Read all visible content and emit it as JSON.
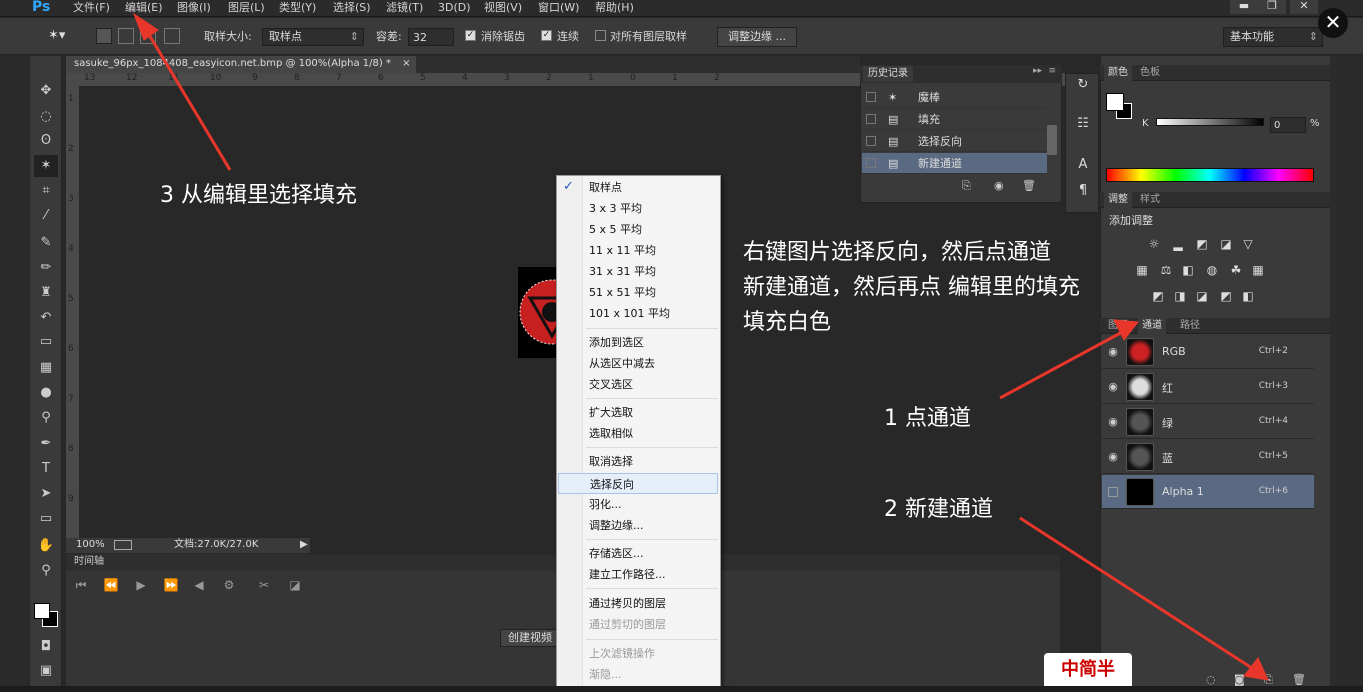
{
  "app": {
    "logo": "Ps"
  },
  "menubar": {
    "items": [
      {
        "label": "文件(F)"
      },
      {
        "label": "编辑(E)"
      },
      {
        "label": "图像(I)"
      },
      {
        "label": "图层(L)"
      },
      {
        "label": "类型(Y)"
      },
      {
        "label": "选择(S)"
      },
      {
        "label": "滤镜(T)"
      },
      {
        "label": "3D(D)"
      },
      {
        "label": "视图(V)"
      },
      {
        "label": "窗口(W)"
      },
      {
        "label": "帮助(H)"
      }
    ],
    "window_buttons": [
      "▬",
      "❐",
      "✕"
    ],
    "close_overlay": "✕"
  },
  "options": {
    "sample_size_label": "取样大小:",
    "sample_size_value": "取样点",
    "tolerance_label": "容差:",
    "tolerance_value": "32",
    "anti_alias_label": "消除锯齿",
    "contiguous_label": "连续",
    "all_layers_label": "对所有图层取样",
    "refine_edge_label": "调整边缘 ...",
    "workspace_label": "基本功能"
  },
  "document": {
    "tab_title": "sasuke_96px_1084408_easyicon.net.bmp @ 100%(Alpha 1/8) *",
    "tab_close": "×",
    "ruler_h": [
      "13",
      "12",
      "11",
      "10",
      "9",
      "8",
      "7",
      "6",
      "5",
      "4",
      "3",
      "2",
      "1",
      "0",
      "1",
      "2"
    ],
    "ruler_v": [
      "1",
      "2",
      "3",
      "4",
      "5",
      "6",
      "7",
      "8",
      "9"
    ],
    "zoom": "100%",
    "doc_info": "文档:27.0K/27.0K"
  },
  "timeline": {
    "tab_label": "时间轴",
    "create_video_label": "创建视频"
  },
  "history": {
    "title": "历史记录",
    "items": [
      {
        "label": "魔棒",
        "icon": "magic-wand-icon"
      },
      {
        "label": "填充",
        "icon": "document-icon"
      },
      {
        "label": "选择反向",
        "icon": "document-icon"
      },
      {
        "label": "新建通道",
        "icon": "document-icon"
      }
    ],
    "selected_index": 3
  },
  "right_panels": {
    "color_tabs": [
      "颜色",
      "色板"
    ],
    "k_label": "K",
    "k_value": "0",
    "k_unit": "%",
    "adjust_tabs": [
      "调整",
      "样式"
    ],
    "add_adjustment": "添加调整",
    "layer_tabs": [
      "图层",
      "通道",
      "路径"
    ],
    "channels": [
      {
        "name": "RGB",
        "shortcut": "Ctrl+2"
      },
      {
        "name": "红",
        "shortcut": "Ctrl+3"
      },
      {
        "name": "绿",
        "shortcut": "Ctrl+4"
      },
      {
        "name": "蓝",
        "shortcut": "Ctrl+5"
      },
      {
        "name": "Alpha 1",
        "shortcut": "Ctrl+6"
      }
    ]
  },
  "context_menu": {
    "items": [
      {
        "label": "取样点",
        "checked": true
      },
      {
        "label": "3 x 3 平均"
      },
      {
        "label": "5 x 5 平均"
      },
      {
        "label": "11 x 11 平均"
      },
      {
        "label": "31 x 31 平均"
      },
      {
        "label": "51 x 51 平均"
      },
      {
        "label": "101 x 101 平均"
      },
      {
        "label": "添加到选区"
      },
      {
        "label": "从选区中减去"
      },
      {
        "label": "交叉选区"
      },
      {
        "label": "扩大选取"
      },
      {
        "label": "选取相似"
      },
      {
        "label": "取消选择"
      },
      {
        "label": "选择反向"
      },
      {
        "label": "羽化..."
      },
      {
        "label": "调整边缘..."
      },
      {
        "label": "存储选区..."
      },
      {
        "label": "建立工作路径..."
      },
      {
        "label": "通过拷贝的图层"
      },
      {
        "label": "通过剪切的图层"
      },
      {
        "label": "上次滤镜操作"
      },
      {
        "label": "渐隐..."
      }
    ],
    "check_mark": "✓"
  },
  "annotations": {
    "step3": "3 从编辑里选择填充",
    "instructions": [
      "右键图片选择反向，然后点通道",
      "新建通道，然后再点 编辑里的填充",
      "填充白色"
    ],
    "step1": "1 点通道",
    "step2": "2 新建通道"
  },
  "watermark_logo": "中简半",
  "colors": {
    "highlight": "#5a6a82",
    "arrow": "#e8362a"
  }
}
